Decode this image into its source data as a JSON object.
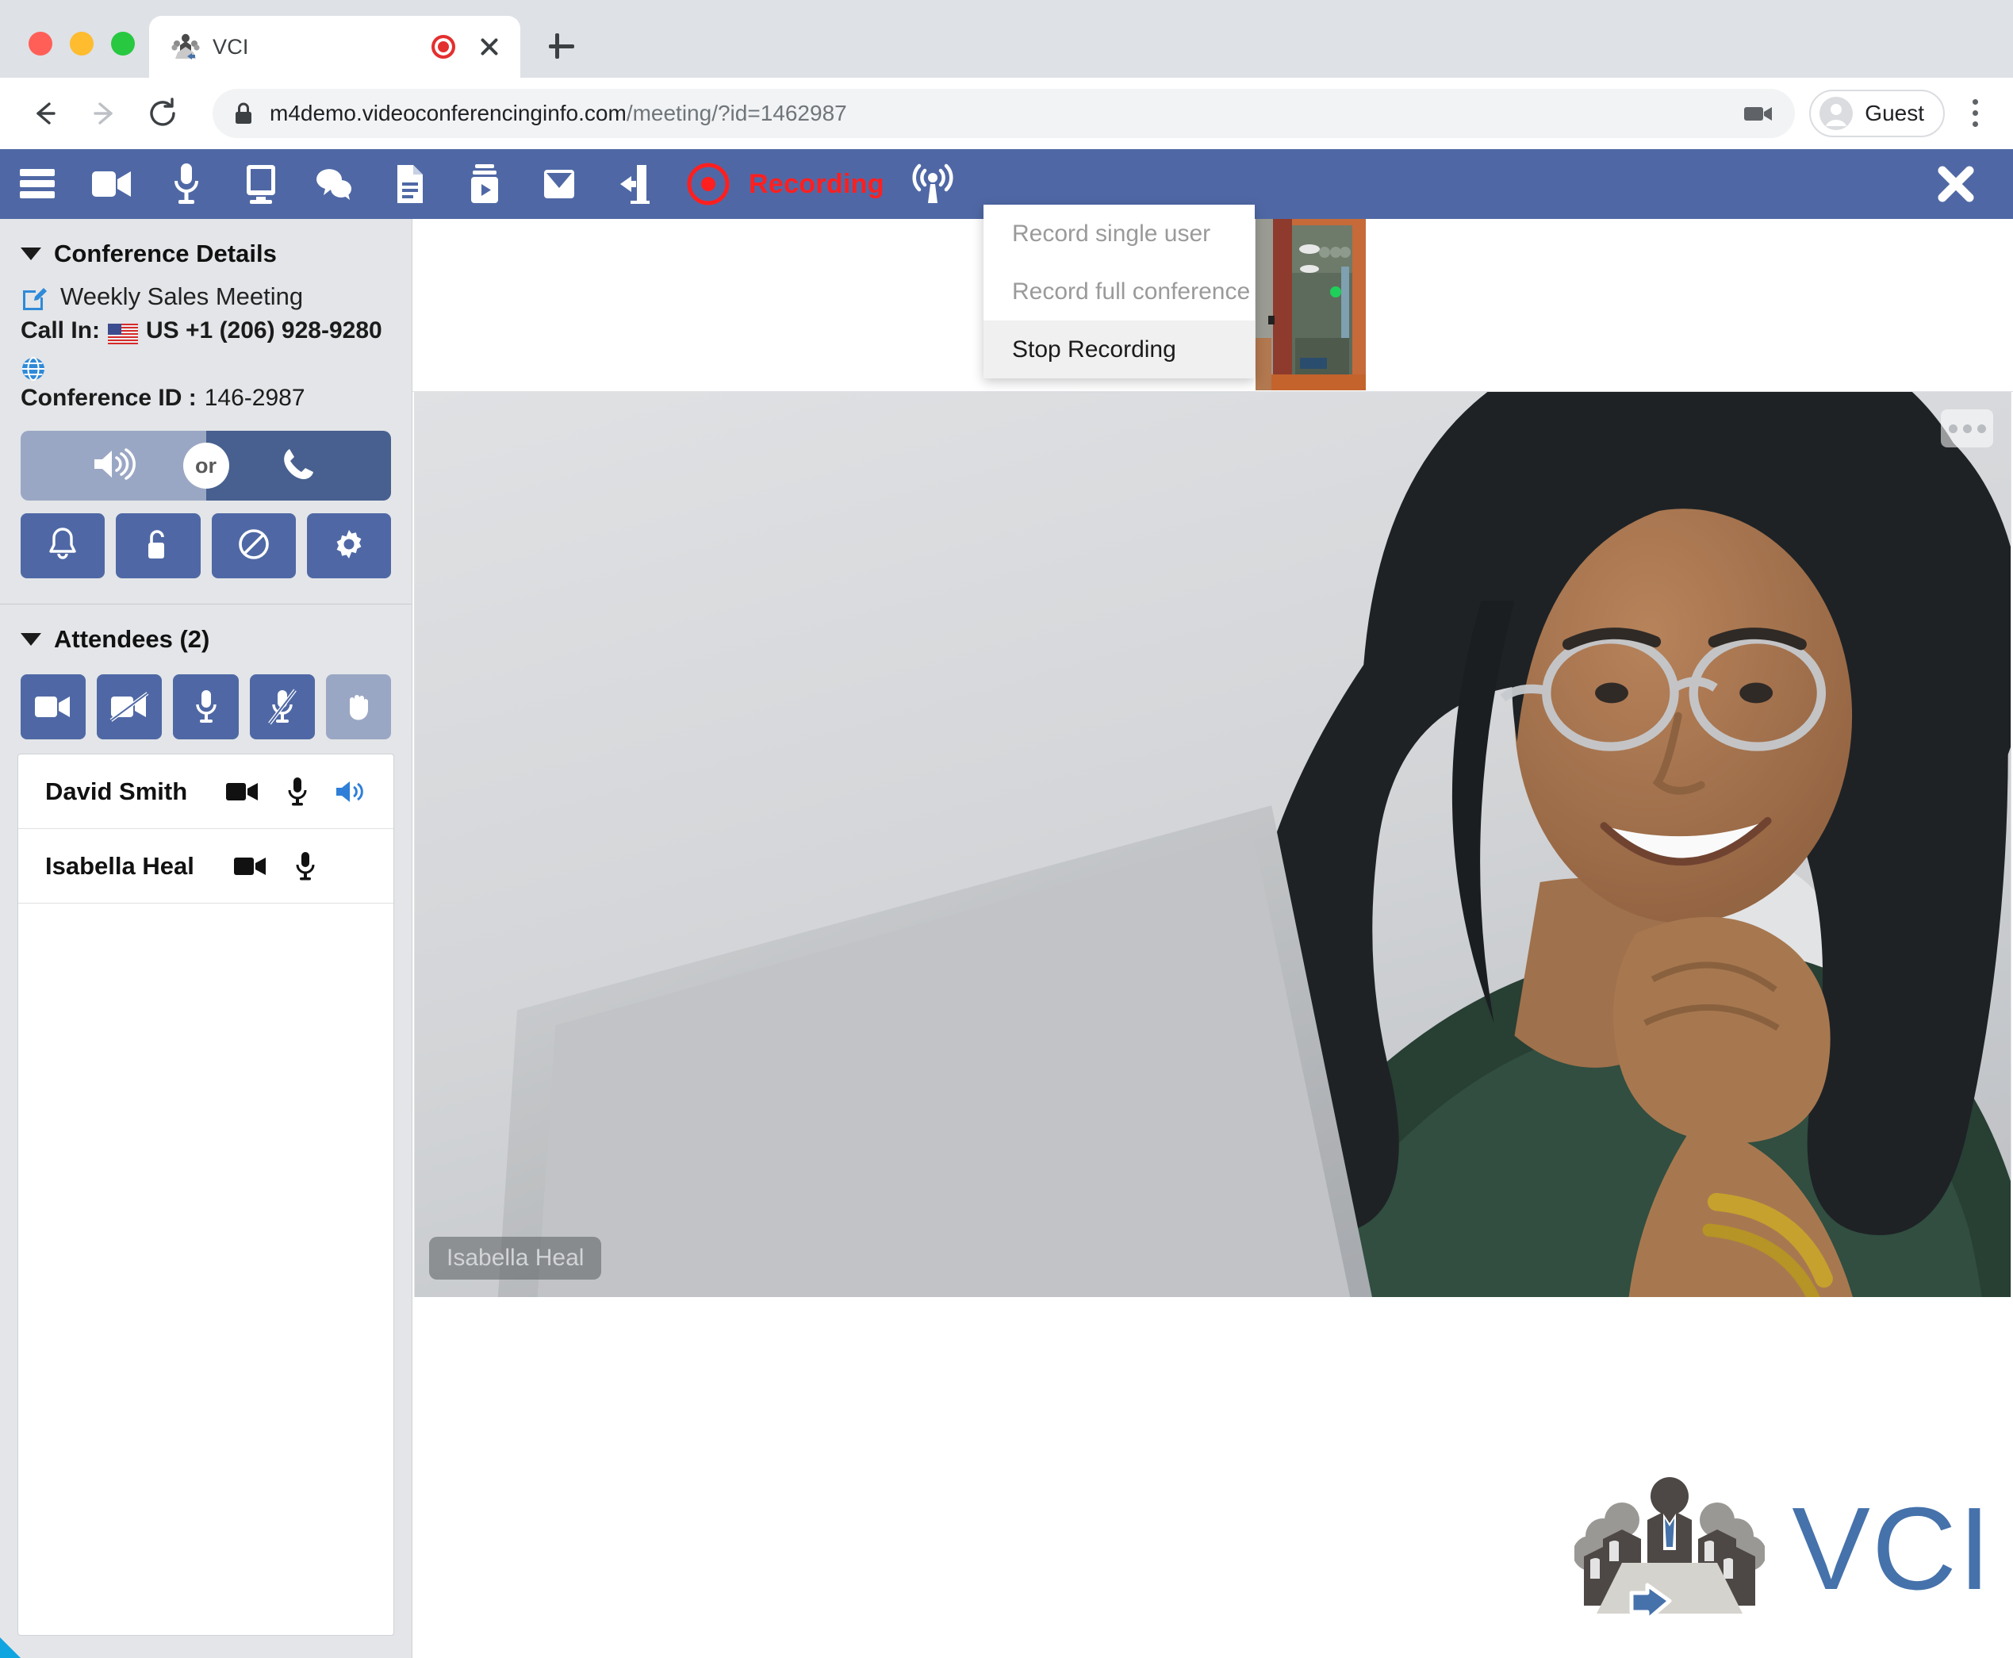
{
  "browser": {
    "tab": {
      "title": "VCI",
      "favicon_icon": "vci-group-icon",
      "recording_indicator_icon": "record-dot-icon",
      "close_icon": "close-icon"
    },
    "new_tab_icon": "plus-icon",
    "nav": {
      "back_icon": "arrow-left-icon",
      "forward_icon": "arrow-right-icon",
      "reload_icon": "reload-icon"
    },
    "url": {
      "lock_icon": "lock-icon",
      "host": "m4demo.videoconferencinginfo.com",
      "path": "/meeting/?id=1462987",
      "camera_icon": "camera-icon"
    },
    "profile": {
      "avatar_icon": "person-avatar-icon",
      "name": "Guest"
    },
    "menu_icon": "kebab-menu-icon"
  },
  "toolbar": {
    "accent_color": "#4f68a5",
    "recording_color": "#ff1f1f",
    "items": [
      {
        "name": "hamburger-menu",
        "icon": "hamburger-icon"
      },
      {
        "name": "video-camera",
        "icon": "video-camera-icon"
      },
      {
        "name": "microphone",
        "icon": "microphone-icon"
      },
      {
        "name": "share-screen",
        "icon": "monitor-icon"
      },
      {
        "name": "chat",
        "icon": "chat-bubbles-icon"
      },
      {
        "name": "documents",
        "icon": "document-icon"
      },
      {
        "name": "media-player",
        "icon": "media-play-icon"
      },
      {
        "name": "invite-email",
        "icon": "envelope-icon"
      },
      {
        "name": "leave-room",
        "icon": "exit-door-icon"
      },
      {
        "name": "record",
        "icon": "record-circle-icon"
      }
    ],
    "recording_label": "Recording",
    "broadcast_icon": "broadcast-tower-icon",
    "close_icon": "close-x-icon"
  },
  "record_menu": {
    "items": [
      {
        "label": "Record single user",
        "enabled": false
      },
      {
        "label": "Record full conference",
        "enabled": false
      },
      {
        "label": "Stop Recording",
        "enabled": true
      }
    ]
  },
  "sidebar": {
    "conference": {
      "section_title": "Conference Details",
      "caret_icon": "caret-down-icon",
      "edit_icon": "edit-pencil-icon",
      "meeting_title": "Weekly Sales Meeting",
      "call_in_label": "Call In:",
      "flag_icon": "us-flag-icon",
      "call_in_number": "US +1 (206) 928-9280",
      "globe_icon": "globe-icon",
      "conference_id_label": "Conference ID :",
      "conference_id": "146-2987",
      "or_label": "or",
      "speaker_icon": "speaker-volume-icon",
      "phone_icon": "phone-handset-icon",
      "action_buttons": [
        {
          "name": "notifications",
          "icon": "bell-icon"
        },
        {
          "name": "lock-room",
          "icon": "unlocked-padlock-icon"
        },
        {
          "name": "block",
          "icon": "no-entry-icon"
        },
        {
          "name": "settings",
          "icon": "gear-icon"
        }
      ]
    },
    "attendees": {
      "section_title": "Attendees (2)",
      "caret_icon": "caret-down-icon",
      "controls": [
        {
          "name": "enable-all-video",
          "icon": "video-camera-icon",
          "active": false
        },
        {
          "name": "disable-all-video",
          "icon": "video-camera-off-icon",
          "active": false
        },
        {
          "name": "unmute-all",
          "icon": "microphone-icon",
          "active": false
        },
        {
          "name": "mute-all",
          "icon": "microphone-off-icon",
          "active": false
        },
        {
          "name": "raise-hand",
          "icon": "hand-icon",
          "active": true
        }
      ],
      "list": [
        {
          "name": "David Smith",
          "icons": [
            "video-camera-icon",
            "microphone-icon",
            "speaker-volume-icon"
          ]
        },
        {
          "name": "Isabella Heal",
          "icons": [
            "video-camera-icon",
            "microphone-icon"
          ]
        }
      ]
    }
  },
  "stage": {
    "thumbnail_name": "participant-thumbnail",
    "video_name_tag": "Isabella Heal",
    "more_options_icon": "ellipsis-icon",
    "logo": {
      "mark_icon": "vci-conference-table-icon",
      "word": "VCI",
      "color": "#4672ab"
    }
  }
}
